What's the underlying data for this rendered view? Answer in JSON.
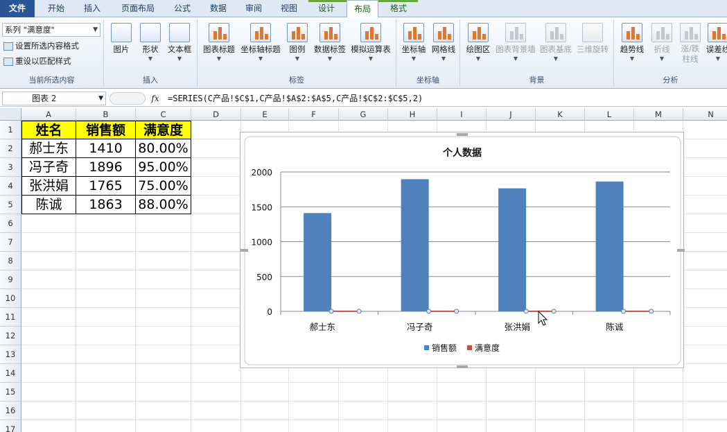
{
  "tabs": [
    "文件",
    "开始",
    "插入",
    "页面布局",
    "公式",
    "数据",
    "审阅",
    "视图",
    "设计",
    "布局",
    "格式"
  ],
  "active_tab": "布局",
  "ribbon": {
    "current_selection": {
      "dropdown_value": "系列 \"满意度\"",
      "format_selection_label": "设置所选内容格式",
      "reset_style_label": "重设以匹配样式",
      "group_label": "当前所选内容"
    },
    "insert": {
      "buttons": [
        "图片",
        "形状",
        "文本框"
      ],
      "group_label": "插入"
    },
    "labels": {
      "buttons": [
        "图表标题",
        "坐标轴标题",
        "图例",
        "数据标签",
        "模拟运算表"
      ],
      "group_label": "标签"
    },
    "axes": {
      "buttons": [
        "坐标轴",
        "网格线"
      ],
      "group_label": "坐标轴"
    },
    "background": {
      "buttons": [
        "绘图区",
        "图表背景墙",
        "图表基底",
        "三维旋转"
      ],
      "group_label": "背景"
    },
    "analysis": {
      "buttons": [
        "趋势线",
        "折线",
        "涨/跌\n柱线",
        "误差线"
      ],
      "group_label": "分析"
    }
  },
  "formula_bar": {
    "name_box": "图表 2",
    "fx": "fx",
    "formula": "=SERIES(C产品!$C$1,C产品!$A$2:$A$5,C产品!$C$2:$C$5,2)"
  },
  "columns": [
    "A",
    "B",
    "C",
    "D",
    "E",
    "F",
    "G",
    "H",
    "I",
    "J",
    "K",
    "L",
    "M",
    "N"
  ],
  "rows": [
    "1",
    "2",
    "3",
    "4",
    "5",
    "6",
    "7",
    "8",
    "9",
    "10",
    "11",
    "12",
    "13",
    "14",
    "15",
    "16",
    "17"
  ],
  "table": {
    "headers": [
      "姓名",
      "销售额",
      "满意度"
    ],
    "rows": [
      [
        "郝士东",
        "1410",
        "80.00%"
      ],
      [
        "冯子奇",
        "1896",
        "95.00%"
      ],
      [
        "张洪娟",
        "1765",
        "75.00%"
      ],
      [
        "陈诚",
        "1863",
        "88.00%"
      ]
    ]
  },
  "chart_data": {
    "type": "bar",
    "title": "个人数据",
    "categories": [
      "郝士东",
      "冯子奇",
      "张洪娟",
      "陈诚"
    ],
    "series": [
      {
        "name": "销售额",
        "values": [
          1410,
          1896,
          1765,
          1863
        ],
        "color": "#4f81bd"
      },
      {
        "name": "满意度",
        "values": [
          0.8,
          0.95,
          0.75,
          0.88
        ],
        "color": "#c0504d"
      }
    ],
    "yticks": [
      "0",
      "500",
      "1000",
      "1500",
      "2000"
    ],
    "ylim": [
      0,
      2000
    ],
    "grid": true,
    "legend": "bottom"
  }
}
